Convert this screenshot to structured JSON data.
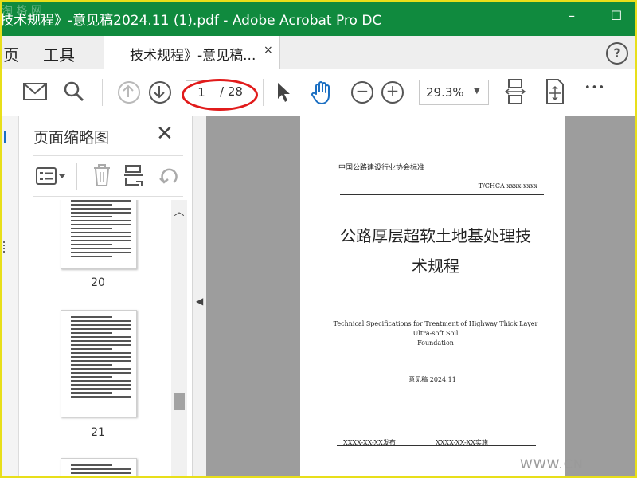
{
  "window": {
    "title": "技术规程》-意见稿2024.11 (1).pdf - Adobe Acrobat Pro DC",
    "watermark_logo": "淘 格 网",
    "minimize_label": "–",
    "maximize_label": "☐",
    "brand_color": "#108a3e"
  },
  "menubar": {
    "home_label": "页",
    "tools_label": "工具"
  },
  "tab": {
    "label": "技术规程》-意见稿...",
    "close_label": "×"
  },
  "help_label": "?",
  "toolbar": {
    "prev_page_icon": "arrow-up-circle-icon",
    "next_page_icon": "arrow-down-circle-icon",
    "current_page": "1",
    "total_pages": "/ 28",
    "zoom_value": "29.3%",
    "zoom_out_label": "−",
    "zoom_in_label": "+",
    "more_label": "•••",
    "highlight_color": "#e11b1b"
  },
  "thumbnail_panel": {
    "title": "页面缩略图",
    "close_label": "✕",
    "pages": [
      {
        "number": "20"
      },
      {
        "number": "21"
      }
    ]
  },
  "document": {
    "organization": "中国公路建设行业协会标准",
    "standard_code": "T/CHCA xxxx-xxxx",
    "title_line1": "公路厚层超软土地基处理技",
    "title_line2": "术规程",
    "english_title_line1": "Technical Specifications for Treatment of Highway Thick Layer Ultra-soft Soil",
    "english_title_line2": "Foundation",
    "draft_label": "意见稿 2024.11",
    "publish_label": "XXXX-XX-XX发布",
    "implement_label": "XXXX-XX-XX实施"
  },
  "site_watermark": "WWW.CN"
}
